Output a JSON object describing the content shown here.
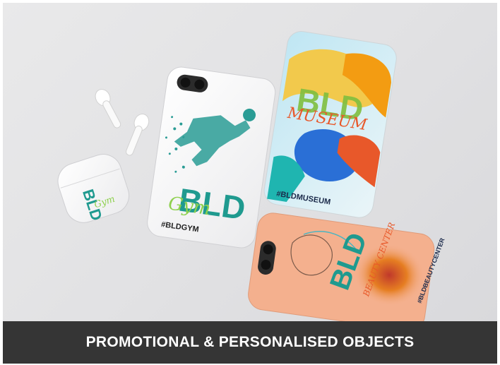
{
  "card": {
    "caption": "PROMOTIONAL & PERSONALISED OBJECTS"
  },
  "products": {
    "earbuds_case": {
      "brand_mark": "BLD",
      "script_word": "Gym"
    },
    "gym_case": {
      "brand_mark": "BLD",
      "script_word": "Gym",
      "handle": "#BLDGYM"
    },
    "museum_case": {
      "brand_mark": "BLD",
      "script_word": "MUSEUM",
      "handle": "#BLDMUSEUM"
    },
    "beauty_case": {
      "brand_mark": "BLD",
      "script_word": "BEAUTY CENTER",
      "handle": "#BLDBEAUTYCENTER"
    }
  },
  "colors": {
    "background": "#e4e4e6",
    "caption_bar": "#353535",
    "brand_teal": "#1f9a8f",
    "brand_green": "#8fd14f",
    "museum_orange": "#e8582a",
    "beauty_peach": "#f4b08e"
  }
}
